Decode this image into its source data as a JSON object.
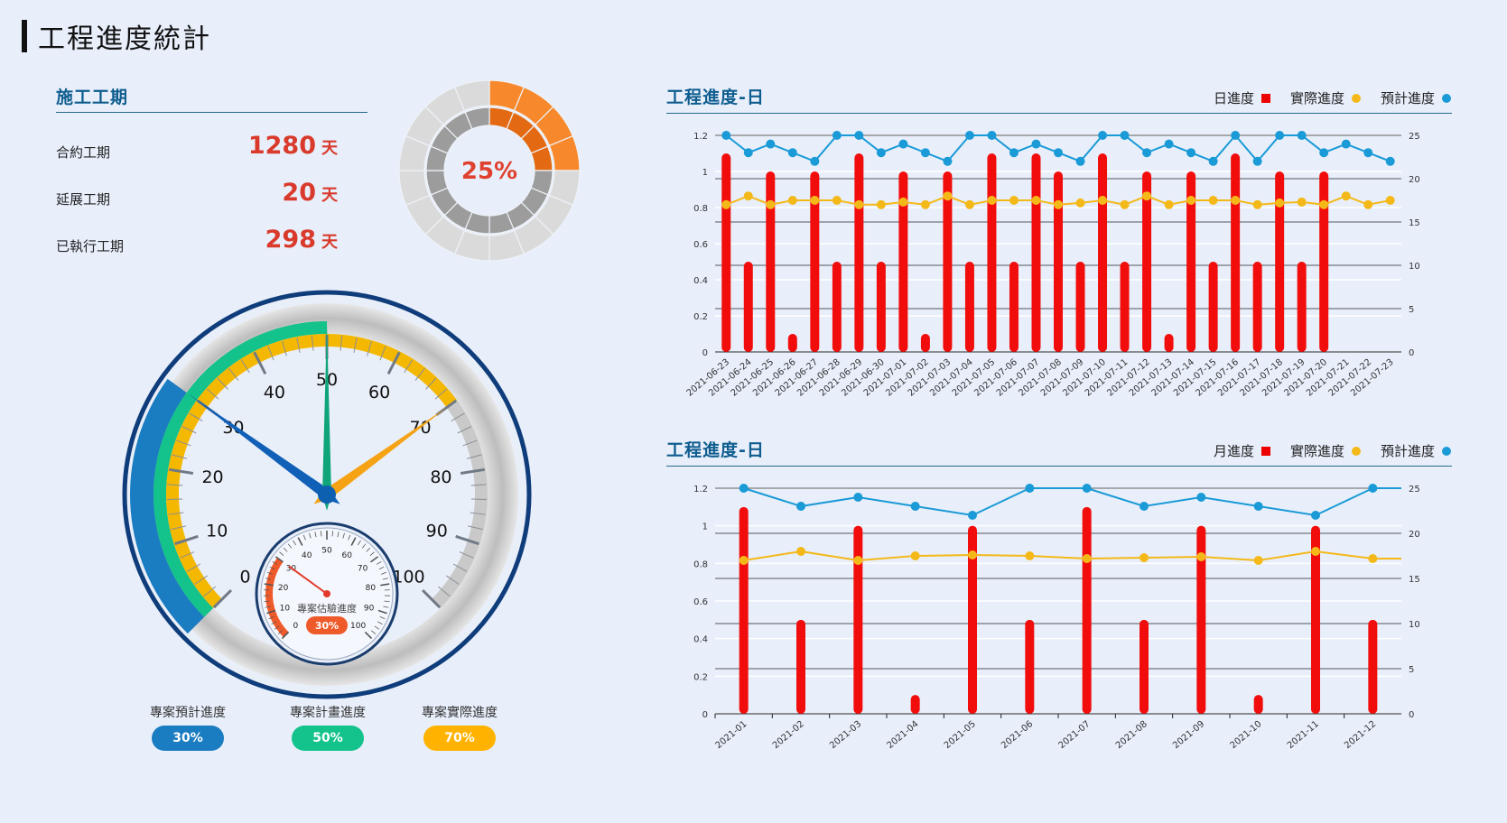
{
  "page_title": "工程進度統計",
  "duration": {
    "title": "施工工期",
    "items": [
      {
        "label": "合約工期",
        "value": "1280",
        "unit": "天"
      },
      {
        "label": "延展工期",
        "value": "20",
        "unit": "天"
      },
      {
        "label": "已執行工期",
        "value": "298",
        "unit": "天"
      }
    ]
  },
  "donut": {
    "label": "25%",
    "percent": 25,
    "color_active": "#f7892c",
    "color_inactive": "#d6d6d6"
  },
  "gauge": {
    "main_ticks": [
      "0",
      "10",
      "20",
      "30",
      "40",
      "50",
      "60",
      "70",
      "80",
      "90",
      "100"
    ],
    "planned_value": 30,
    "plan_value": 50,
    "actual_value": 70,
    "sub_label": "專案估驗進度",
    "sub_badge": "30%",
    "sub_value": 30,
    "sub_ticks": [
      "0",
      "10",
      "20",
      "30",
      "40",
      "50",
      "60",
      "70",
      "80",
      "90",
      "100"
    ]
  },
  "pills": [
    {
      "label": "專案預計進度",
      "value": "30%",
      "color": "#1a7cc1"
    },
    {
      "label": "專案計畫進度",
      "value": "50%",
      "color": "#14c28b"
    },
    {
      "label": "專案實際進度",
      "value": "70%",
      "color": "#ffb300"
    }
  ],
  "colors": {
    "bar": "#f20d0d",
    "actual": "#f4b919",
    "planned": "#1a9ad6",
    "title": "#0f5d8f"
  },
  "chart_data": [
    {
      "type": "bar",
      "title": "工程進度-日",
      "legend": [
        "日進度",
        "實際進度",
        "預計進度"
      ],
      "categories": [
        "2021-06-23",
        "2021-06-24",
        "2021-06-25",
        "2021-06-26",
        "2021-06-27",
        "2021-06-28",
        "2021-06-29",
        "2021-06-30",
        "2021-07-01",
        "2021-07-02",
        "2021-07-03",
        "2021-07-04",
        "2021-07-05",
        "2021-07-06",
        "2021-07-07",
        "2021-07-08",
        "2021-07-09",
        "2021-07-10",
        "2021-07-11",
        "2021-07-12",
        "2021-07-13",
        "2021-07-14",
        "2021-07-15",
        "2021-07-16",
        "2021-07-17",
        "2021-07-18",
        "2021-07-19",
        "2021-07-20",
        "2021-07-21",
        "2021-07-22",
        "2021-07-23"
      ],
      "y_left_ticks": [
        "0",
        "0.2",
        "0.4",
        "0.6",
        "0.8",
        "1",
        "1.2"
      ],
      "y_right_ticks": [
        "0",
        "5",
        "10",
        "15",
        "20",
        "25"
      ],
      "ylim_left": [
        0,
        1.2
      ],
      "ylim_right": [
        0,
        25
      ],
      "series": [
        {
          "name": "日進度",
          "axis": "left",
          "values": [
            1.1,
            0.5,
            1.0,
            0.1,
            1.0,
            0.5,
            1.1,
            0.5,
            1.0,
            0.1,
            1.0,
            0.5,
            1.1,
            0.5,
            1.1,
            1.0,
            0.5,
            1.1,
            0.5,
            1.0,
            0.1,
            1.0,
            0.5,
            1.1,
            0.5,
            1.0,
            0.5,
            1.0,
            null,
            null,
            null
          ]
        },
        {
          "name": "實際進度",
          "axis": "right",
          "values": [
            17,
            18,
            17,
            17.5,
            17.5,
            17.5,
            17,
            17,
            17.3,
            17,
            18,
            17,
            17.5,
            17.5,
            17.5,
            17,
            17.2,
            17.5,
            17,
            18,
            17,
            17.5,
            17.5,
            17.5,
            17,
            17.2,
            17.3,
            17,
            18,
            17,
            17.5
          ]
        },
        {
          "name": "預計進度",
          "axis": "right",
          "values": [
            25,
            23,
            24,
            23,
            22,
            25,
            25,
            23,
            24,
            23,
            22,
            25,
            25,
            23,
            24,
            23,
            22,
            25,
            25,
            23,
            24,
            23,
            22,
            25,
            22,
            25,
            25,
            23,
            24,
            23,
            22
          ]
        }
      ]
    },
    {
      "type": "bar",
      "title": "工程進度-日",
      "legend": [
        "月進度",
        "實際進度",
        "預計進度"
      ],
      "categories": [
        "2021-01",
        "2021-02",
        "2021-03",
        "2021-04",
        "2021-05",
        "2021-06",
        "2021-07",
        "2021-08",
        "2021-09",
        "2021-10",
        "2021-11",
        "2021-12"
      ],
      "y_left_ticks": [
        "0",
        "0.2",
        "0.4",
        "0.6",
        "0.8",
        "1",
        "1.2"
      ],
      "y_right_ticks": [
        "0",
        "5",
        "10",
        "15",
        "20",
        "25"
      ],
      "ylim_left": [
        0,
        1.2
      ],
      "ylim_right": [
        0,
        25
      ],
      "series": [
        {
          "name": "月進度",
          "axis": "left",
          "values": [
            1.1,
            0.5,
            1.0,
            0.1,
            1.0,
            0.5,
            1.1,
            0.5,
            1.0,
            0.1,
            1.0,
            0.5
          ]
        },
        {
          "name": "實際進度",
          "axis": "right",
          "values": [
            17,
            18,
            17,
            17.5,
            17.6,
            17.5,
            17.2,
            17.3,
            17.4,
            17,
            18,
            17.2
          ]
        },
        {
          "name": "預計進度",
          "axis": "right",
          "values": [
            25,
            23,
            24,
            23,
            22,
            25,
            25,
            23,
            24,
            23,
            22,
            25
          ]
        }
      ]
    }
  ]
}
